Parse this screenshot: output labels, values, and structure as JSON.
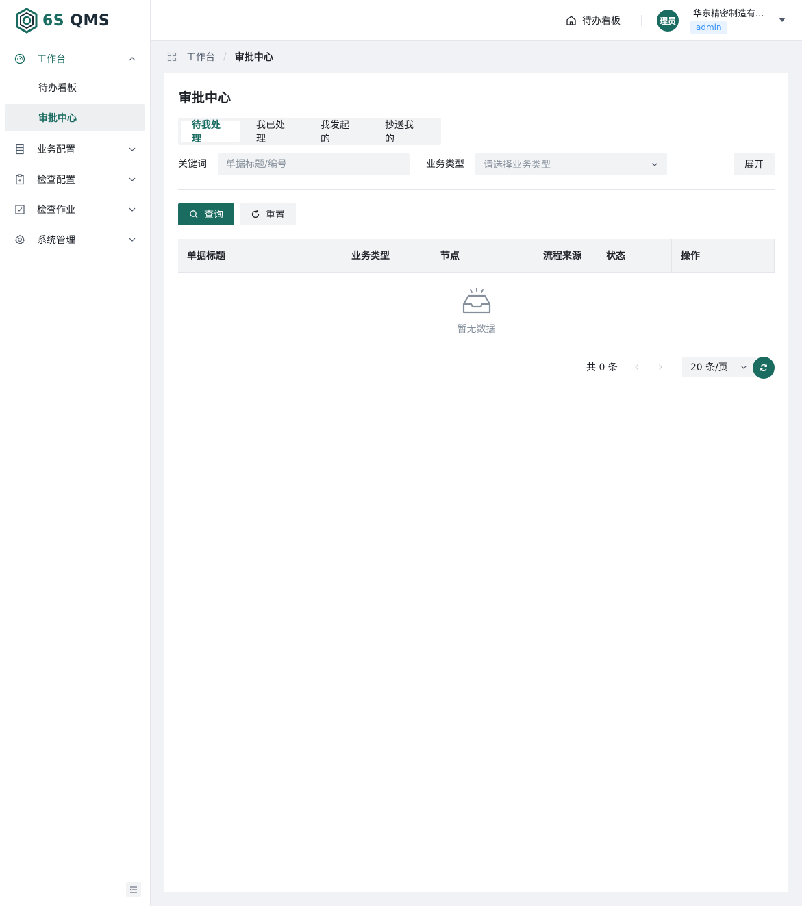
{
  "app": {
    "logo_text_prefix": "6S",
    "logo_text_suffix": " QMS",
    "brand_color": "#1a6b60"
  },
  "sidebar": {
    "items": [
      {
        "label": "工作台",
        "icon": "dashboard-icon",
        "expanded": true,
        "children": [
          {
            "label": "待办看板",
            "selected": false
          },
          {
            "label": "审批中心",
            "selected": true
          }
        ]
      },
      {
        "label": "业务配置",
        "icon": "ledger-icon",
        "expanded": false
      },
      {
        "label": "检查配置",
        "icon": "clipboard-icon",
        "expanded": false
      },
      {
        "label": "检查作业",
        "icon": "checkbox-icon",
        "expanded": false
      },
      {
        "label": "系统管理",
        "icon": "gear-icon",
        "expanded": false
      }
    ]
  },
  "header": {
    "todo_link": "待办看板",
    "avatar_text": "理员",
    "company": "华东精密制造有...",
    "role": "admin"
  },
  "breadcrumb": {
    "items": [
      "工作台",
      "审批中心"
    ],
    "separator": "/"
  },
  "page": {
    "title": "审批中心",
    "tabs": [
      {
        "label": "待我处理",
        "active": true
      },
      {
        "label": "我已处理",
        "active": false
      },
      {
        "label": "我发起的",
        "active": false
      },
      {
        "label": "抄送我的",
        "active": false
      }
    ],
    "filters": {
      "keyword_label": "关键词",
      "keyword_placeholder": "单据标题/编号",
      "type_label": "业务类型",
      "type_placeholder": "请选择业务类型",
      "expand_label": "展开"
    },
    "buttons": {
      "query": "查询",
      "reset": "重置"
    },
    "table": {
      "columns": [
        "单据标题",
        "业务类型",
        "节点",
        "流程来源",
        "状态",
        "操作"
      ],
      "rows": [],
      "empty_text": "暂无数据"
    },
    "pagination": {
      "total_text": "共 0 条",
      "page_size": "20 条/页"
    }
  }
}
